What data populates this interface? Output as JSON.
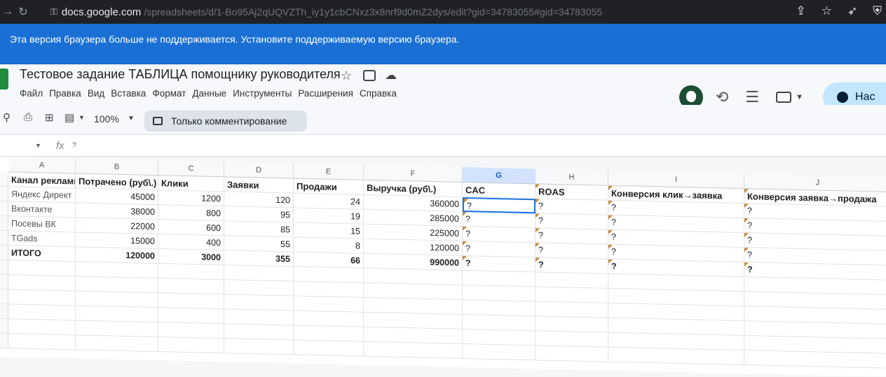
{
  "browser": {
    "domain": "docs.google.com",
    "path": "/spreadsheets/d/1-Bo95Aj2qUQVZTh_iy1y1cbCNxz3x8nrf9d0mZ2dys/edit?gid=34783055#gid=34783055"
  },
  "banner": {
    "text": "Эта версия браузера больше не поддерживается. Установите поддерживаемую версию браузера."
  },
  "doc": {
    "title": "Тестовое задание ТАБЛИЦА помощнику руководителя"
  },
  "menu": [
    "Файл",
    "Правка",
    "Вид",
    "Вставка",
    "Формат",
    "Данные",
    "Инструменты",
    "Расширения",
    "Справка"
  ],
  "share_label": "Нас",
  "toolbar": {
    "zoom": "100%",
    "mode": "Только комментирование"
  },
  "formula_bar": {
    "value": "?"
  },
  "columns": [
    "A",
    "B",
    "C",
    "D",
    "E",
    "F",
    "G",
    "H",
    "I",
    "J"
  ],
  "selected_column": "G",
  "header_row": [
    "Канал рекламы",
    "Потрачено (руб\\.)",
    "Клики",
    "Заявки",
    "Продажи",
    "Выручка (руб\\.)",
    "CAC",
    "ROAS",
    "Конверсия клик→заявка",
    "Конверсия заявка→продажа"
  ],
  "rows": [
    [
      "Яндекс Директ",
      "45000",
      "1200",
      "120",
      "24",
      "360000",
      "?",
      "?",
      "?",
      "?"
    ],
    [
      "Вконтакте",
      "38000",
      "800",
      "95",
      "19",
      "285000",
      "?",
      "?",
      "?",
      "?"
    ],
    [
      "Посевы ВК",
      "22000",
      "600",
      "85",
      "15",
      "225000",
      "?",
      "?",
      "?",
      "?"
    ],
    [
      "TGads",
      "15000",
      "400",
      "55",
      "8",
      "120000",
      "?",
      "?",
      "?",
      "?"
    ]
  ],
  "total_row": [
    "ИТОГО",
    "120000",
    "3000",
    "355",
    "66",
    "990000",
    "?",
    "?",
    "?",
    "?"
  ],
  "colors": {
    "banner": "#1a6fd4",
    "selected_column": "#d3e3fd",
    "active_border": "#1a73e8",
    "note_marker": "#c78a36"
  }
}
